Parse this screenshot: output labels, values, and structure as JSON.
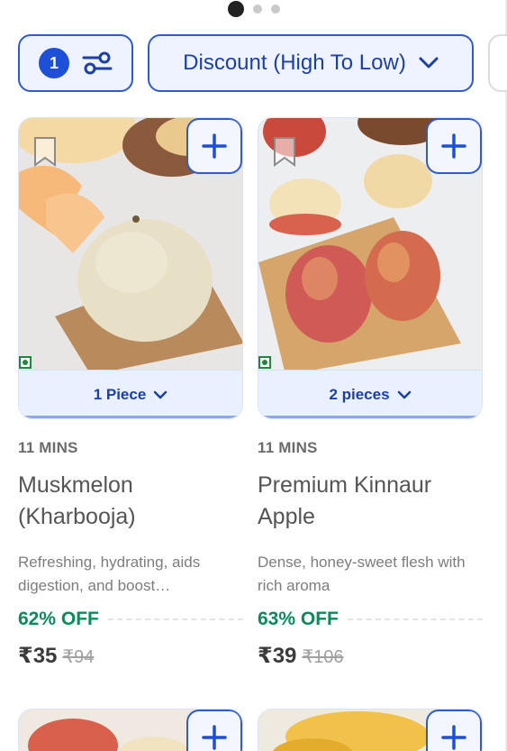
{
  "pager": {
    "pages": 3,
    "active": 0
  },
  "filter": {
    "count": "1",
    "sort_label": "Discount (High To Low)"
  },
  "products": [
    {
      "eta": "11 MINS",
      "name": "Muskmelon (Kharbooja)",
      "desc": "Refreshing, hydrating, aids digestion, and boost…",
      "qty": "1 Piece",
      "off": "62% OFF",
      "price": "₹35",
      "mrp": "₹94"
    },
    {
      "eta": "11 MINS",
      "name": "Premium Kinnaur Apple",
      "desc": "Dense, honey-sweet flesh with rich aroma",
      "qty": "2 pieces",
      "off": "63% OFF",
      "price": "₹39",
      "mrp": "₹106"
    }
  ],
  "colors": {
    "accent": "#1d4fd8",
    "discount": "#0b8a5a",
    "veg": "#1b8a3a"
  }
}
